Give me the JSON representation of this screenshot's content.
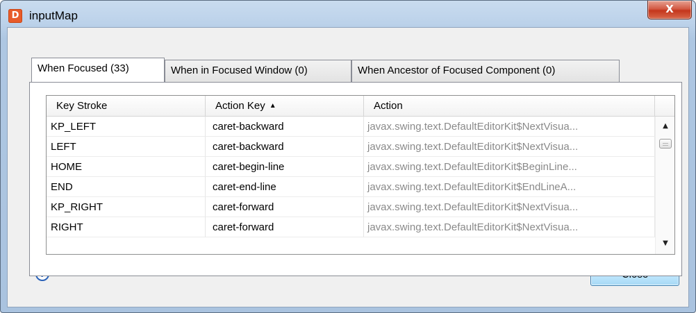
{
  "window": {
    "title": "inputMap",
    "app_icon_glyph": "D",
    "close_glyph": "X"
  },
  "tabs": [
    {
      "label": "When Focused (33)",
      "active": true
    },
    {
      "label": "When in Focused Window (0)",
      "active": false
    },
    {
      "label": "When Ancestor of Focused Component (0)",
      "active": false
    }
  ],
  "table": {
    "columns": [
      {
        "label": "Key Stroke"
      },
      {
        "label": "Action Key",
        "sort_indicator": "▲"
      },
      {
        "label": "Action"
      }
    ],
    "rows": [
      {
        "key_stroke": "KP_LEFT",
        "action_key": "caret-backward",
        "action": "javax.swing.text.DefaultEditorKit$NextVisua..."
      },
      {
        "key_stroke": "LEFT",
        "action_key": "caret-backward",
        "action": "javax.swing.text.DefaultEditorKit$NextVisua..."
      },
      {
        "key_stroke": "HOME",
        "action_key": "caret-begin-line",
        "action": "javax.swing.text.DefaultEditorKit$BeginLine..."
      },
      {
        "key_stroke": "END",
        "action_key": "caret-end-line",
        "action": "javax.swing.text.DefaultEditorKit$EndLineA..."
      },
      {
        "key_stroke": "KP_RIGHT",
        "action_key": "caret-forward",
        "action": "javax.swing.text.DefaultEditorKit$NextVisua..."
      },
      {
        "key_stroke": "RIGHT",
        "action_key": "caret-forward",
        "action": "javax.swing.text.DefaultEditorKit$NextVisua..."
      }
    ],
    "scroll_up_glyph": "▲",
    "scroll_down_glyph": "▼"
  },
  "footer": {
    "help_glyph": "?",
    "close_label": "Close"
  },
  "colors": {
    "app_icon": "#e85b2a",
    "window_frame": "#aec7e2",
    "close_x": "#c4361c",
    "action_text": "#8a8a8a",
    "close_button": "#bee6fd",
    "help_icon": "#2a62b8"
  }
}
